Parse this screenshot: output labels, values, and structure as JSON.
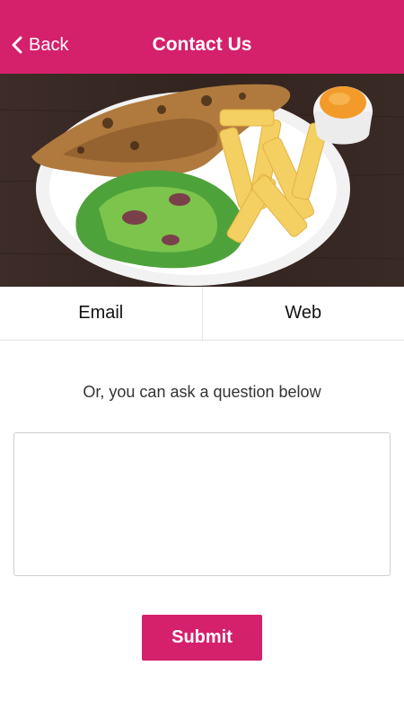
{
  "header": {
    "back_label": "Back",
    "title": "Contact Us",
    "color": "#d5206b"
  },
  "hero": {
    "icon": "food-plate-image"
  },
  "tabs": [
    {
      "label": "Email"
    },
    {
      "label": "Web"
    }
  ],
  "form": {
    "prompt": "Or, you can ask a question below",
    "question_value": "",
    "submit_label": "Submit"
  }
}
